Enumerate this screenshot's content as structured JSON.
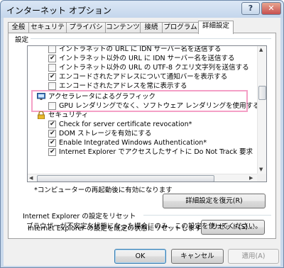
{
  "window": {
    "title": "インターネット オプション",
    "help_label": "?",
    "close_label": "✕"
  },
  "tabs": [
    "全般",
    "セキュリティ",
    "プライバシー",
    "コンテンツ",
    "接続",
    "プログラム",
    "詳細設定"
  ],
  "active_tab": "詳細設定",
  "settings": {
    "section_label": "設定",
    "items": [
      {
        "type": "checkbox",
        "checked": false,
        "label": "イントラネットの URL に IDN サーバー名を送信する"
      },
      {
        "type": "checkbox",
        "checked": true,
        "label": "イントラネット以外の URL に IDN サーバー名を送信する"
      },
      {
        "type": "checkbox",
        "checked": false,
        "label": "イントラネット以外の URL の UTF-8 クエリ文字列を送信する"
      },
      {
        "type": "checkbox",
        "checked": true,
        "label": "エンコードされたアドレスについて通知バーを表示する"
      },
      {
        "type": "checkbox",
        "checked": false,
        "label": "エンコードされたアドレスを常に表示する"
      },
      {
        "type": "category",
        "icon": "monitor-icon",
        "label": "アクセラレータによるグラフィック"
      },
      {
        "type": "checkbox",
        "checked": false,
        "label": "GPU レンダリングでなく、ソフトウェア レンダリングを使用する*"
      },
      {
        "type": "category",
        "icon": "padlock-icon",
        "label": "セキュリティ"
      },
      {
        "type": "checkbox",
        "checked": true,
        "label": "Check for server certificate revocation*"
      },
      {
        "type": "checkbox",
        "checked": true,
        "label": "DOM ストレージを有効にする"
      },
      {
        "type": "checkbox",
        "checked": true,
        "label": "Enable Integrated Windows Authentication*"
      },
      {
        "type": "checkbox",
        "checked": true,
        "label": "Internet Explorer でアクセスしたサイトに Do Not Track 要求を送信する"
      }
    ],
    "scroll_up": "▲",
    "scroll_down": "▼",
    "scroll_left": "◀",
    "scroll_right": "▶",
    "restart_note": "*コンピューターの再起動後に有効になります",
    "restore_button": "詳細設定を復元(R)"
  },
  "reset_section": {
    "label": "Internet Explorer の設定をリセット",
    "description": "Internet Explorer の設定を既定の状態にリセットします。",
    "reset_button": "リセット(S)...",
    "hint": "ブラウザーが不安定な状態になった場合にのみ、この設定を使ってください。"
  },
  "footer": {
    "ok": "OK",
    "cancel": "キャンセル",
    "apply": "適用(A)"
  },
  "colors": {
    "highlight_border": "#f4a0c6",
    "title_bar": "#c4d6ec",
    "close_button": "#c75050"
  }
}
